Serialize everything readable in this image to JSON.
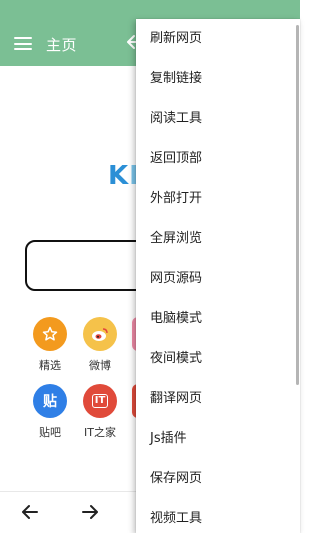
{
  "header": {
    "title": "主页"
  },
  "logo": {
    "part1": "K",
    "part2": "I"
  },
  "shortcuts": [
    {
      "label": "精选",
      "color": "#f39a1e",
      "glyph": "☆"
    },
    {
      "label": "微博",
      "color": "#f5c24a",
      "glyph": ""
    },
    {
      "label": "贴吧",
      "color": "#2f7fe6",
      "glyph": "贴"
    },
    {
      "label": "IT之家",
      "color": "#e04a3a",
      "glyph": "IT"
    }
  ],
  "partial_icon_colors": [
    "#ef8aa6",
    "#e04a3a"
  ],
  "menu": {
    "items": [
      "刷新网页",
      "复制链接",
      "阅读工具",
      "返回顶部",
      "外部打开",
      "全屏浏览",
      "网页源码",
      "电脑模式",
      "夜间模式",
      "翻译网页",
      "Js插件",
      "保存网页",
      "视频工具"
    ]
  },
  "colors": {
    "appbar": "#7bbf94"
  }
}
